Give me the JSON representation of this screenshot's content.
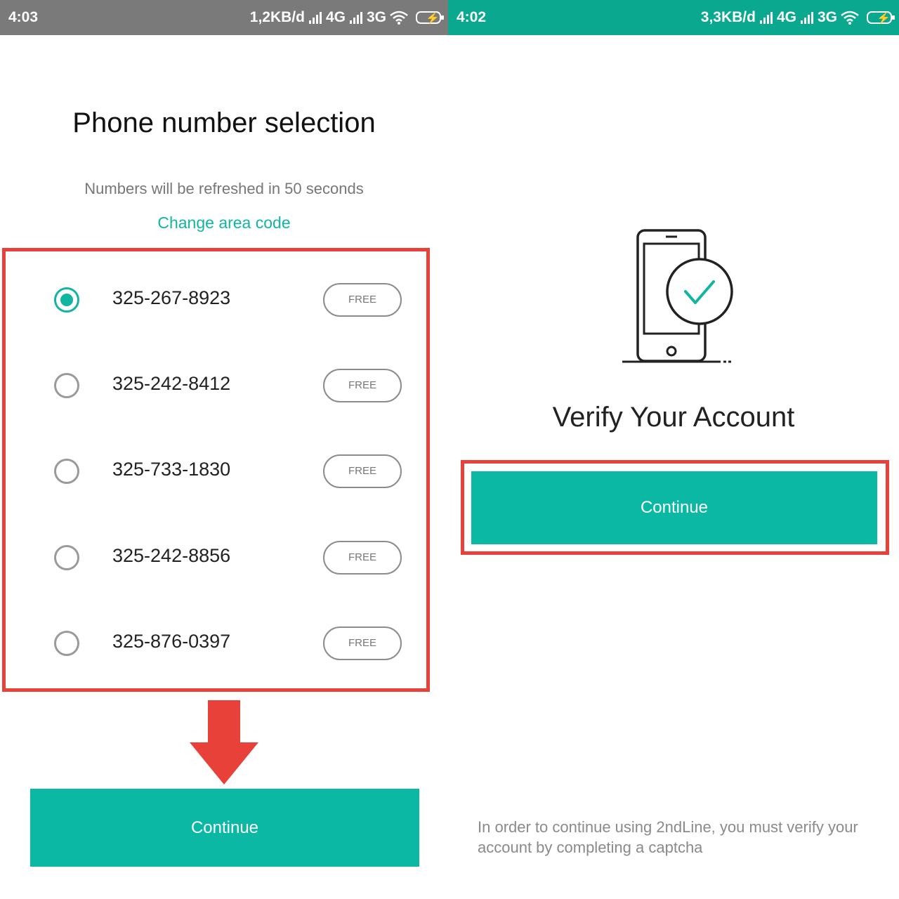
{
  "colors": {
    "accent": "#0bb8a3",
    "highlight": "#e8413a",
    "status_left": "#7a7a7a",
    "status_right": "#0aa88f"
  },
  "left_screen": {
    "status": {
      "time": "4:03",
      "speed": "1,2KB/d",
      "net1": "4G",
      "net2": "3G"
    },
    "title": "Phone number selection",
    "subtitle": "Numbers will be refreshed in 50 seconds",
    "change_area_code": "Change area code",
    "numbers": [
      {
        "number": "325-267-8923",
        "badge": "FREE",
        "selected": true
      },
      {
        "number": "325-242-8412",
        "badge": "FREE",
        "selected": false
      },
      {
        "number": "325-733-1830",
        "badge": "FREE",
        "selected": false
      },
      {
        "number": "325-242-8856",
        "badge": "FREE",
        "selected": false
      },
      {
        "number": "325-876-0397",
        "badge": "FREE",
        "selected": false
      }
    ],
    "continue_label": "Continue"
  },
  "right_screen": {
    "status": {
      "time": "4:02",
      "speed": "3,3KB/d",
      "net1": "4G",
      "net2": "3G"
    },
    "illustration_icon": "phone-verified-icon",
    "title": "Verify Your Account",
    "continue_label": "Continue",
    "note": "In order to continue using 2ndLine, you must verify your account by completing a captcha"
  }
}
